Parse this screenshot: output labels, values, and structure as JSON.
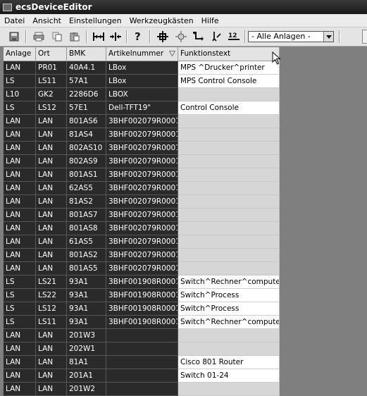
{
  "window": {
    "title": "ecsDeviceEditor"
  },
  "menu": [
    "Datei",
    "Ansicht",
    "Einstellungen",
    "Werkzeugkästen",
    "Hilfe"
  ],
  "toolbar": {
    "filter_value": "- Alle Anlagen -",
    "counter_label": "12"
  },
  "icons": {
    "toolbar": [
      "save-icon",
      "print-icon",
      "copy-icon",
      "paste-icon",
      "split-horizontal-icon",
      "merge-icon",
      "help-icon",
      "crosshair-icon",
      "bulb-icon",
      "terminal-icon",
      "signal-icon",
      "numbering-icon"
    ]
  },
  "table": {
    "columns": [
      "Anlage",
      "Ort",
      "BMK",
      "Artikelnummer",
      "Funktionstext"
    ],
    "rows": [
      [
        "LAN",
        "PR01",
        "40A4.1",
        "LBox",
        "MPS ^Drucker^printer"
      ],
      [
        "LS",
        "LS11",
        "57A1",
        "LBox",
        "MPS Control Console"
      ],
      [
        "L10",
        "GK2",
        "2286D6",
        "LBOX",
        ""
      ],
      [
        "LS",
        "LS12",
        "57E1",
        "Dell-TFT19\"",
        "Control Console"
      ],
      [
        "LAN",
        "LAN",
        "801AS6",
        "3BHF002079R0001",
        ""
      ],
      [
        "LAN",
        "LAN",
        "81AS4",
        "3BHF002079R0001",
        ""
      ],
      [
        "LAN",
        "LAN",
        "802AS10",
        "3BHF002079R0001",
        ""
      ],
      [
        "LAN",
        "LAN",
        "802AS9",
        "3BHF002079R0001",
        ""
      ],
      [
        "LAN",
        "LAN",
        "801AS1",
        "3BHF002079R0001",
        ""
      ],
      [
        "LAN",
        "LAN",
        "62AS5",
        "3BHF002079R0001",
        ""
      ],
      [
        "LAN",
        "LAN",
        "81AS2",
        "3BHF002079R0001",
        ""
      ],
      [
        "LAN",
        "LAN",
        "801AS7",
        "3BHF002079R0001",
        ""
      ],
      [
        "LAN",
        "LAN",
        "801AS8",
        "3BHF002079R0001",
        ""
      ],
      [
        "LAN",
        "LAN",
        "61AS5",
        "3BHF002079R0001",
        ""
      ],
      [
        "LAN",
        "LAN",
        "801AS2",
        "3BHF002079R0001",
        ""
      ],
      [
        "LAN",
        "LAN",
        "801AS5",
        "3BHF002079R0001",
        ""
      ],
      [
        "LS",
        "LS21",
        "93A1",
        "3BHF001908R0001",
        "Switch^Rechner^computer"
      ],
      [
        "LS",
        "LS22",
        "93A1",
        "3BHF001908R0001",
        "Switch^Process"
      ],
      [
        "LS",
        "LS12",
        "93A1",
        "3BHF001908R0001",
        "Switch^Process"
      ],
      [
        "LS",
        "LS11",
        "93A1",
        "3BHF001908R0001",
        "Switch^Rechner^computer"
      ],
      [
        "LAN",
        "LAN",
        "201W3",
        "",
        ""
      ],
      [
        "LAN",
        "LAN",
        "202W1",
        "",
        ""
      ],
      [
        "LAN",
        "LAN",
        "81A1",
        "",
        "Cisco 801 Router"
      ],
      [
        "LAN",
        "LAN",
        "201A1",
        "",
        "Switch 01-24"
      ],
      [
        "LAN",
        "LAN",
        "201W2",
        "",
        ""
      ]
    ]
  },
  "colors": {
    "row_dark": "#2a2a2a",
    "functiontext_bg": "#ffffff",
    "functiontext_empty": "#d6d6d6",
    "workspace": "#7f7f7f"
  }
}
